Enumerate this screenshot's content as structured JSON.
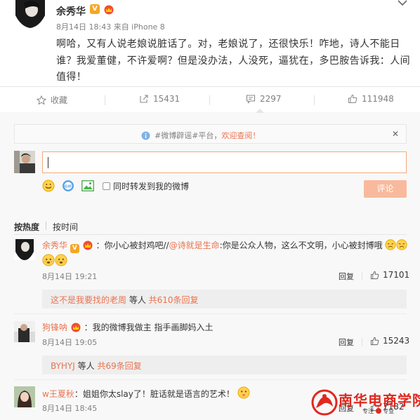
{
  "post": {
    "author": "余秀华",
    "v_badge": "V",
    "meta": "8月14日 18:43 来自 iPhone 8",
    "line1": "啊哈，又有人说老娘说脏话了。对，老娘说了，还很快乐！咋地，诗人不能日",
    "line2": "谁？我爱董健，不许爱啊？但是没办法，人没死，逼犹在，多巴胺告诉我：人间",
    "line3": "值得！"
  },
  "actions": {
    "favorite": "收藏",
    "repost": "15431",
    "comment": "2297",
    "like": "111948"
  },
  "notice": {
    "prefix": "#微博辟谣#平台，",
    "highlight": "欢迎查阅！",
    "close": "✕"
  },
  "composer": {
    "repost_checkbox_label": "同时转发到我的微博",
    "submit_label": "评论"
  },
  "sort": {
    "hot": "按热度",
    "time": "按时间"
  },
  "comments": [
    {
      "name": "余秀华",
      "badge": "V",
      "text_a": "：你小心被封鸡吧//",
      "mention": "@诗就是生命",
      "text_b": ":你是公众人物，这么不文明，小心被封博哦",
      "time": "8月14日 19:21",
      "reply_label": "回复",
      "likes": "17101",
      "sub_lead": "这不是我要找的老周",
      "sub_mid": " 等人 ",
      "sub_count": "共610条回复"
    },
    {
      "name": "狗锋呐",
      "text_a": "：我的微博我做主 指手画脚妈入土",
      "time": "8月14日 19:05",
      "reply_label": "回复",
      "likes": "15243",
      "sub_lead": "BYHYJ",
      "sub_mid": " 等人 ",
      "sub_count": "共69条回复"
    },
    {
      "name": "w王夏秋",
      "text_a": "：姐姐你太slay了！脏话就是语言的艺术！",
      "time": "8月14日 18:45",
      "reply_label": "回复",
      "likes": "7182"
    }
  ],
  "watermark": {
    "title": "南华电商学院",
    "sub1": "专注",
    "sub2": "专业"
  },
  "colors": {
    "accent": "#eb7350",
    "link": "#eb7350",
    "muted": "#808080",
    "badge": "#f5a623"
  }
}
